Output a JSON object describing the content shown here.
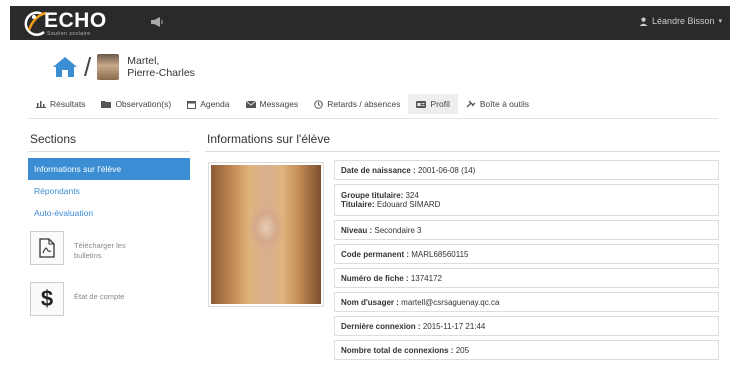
{
  "navbar": {
    "logo_text": "ECHO",
    "logo_subtitle": "Soutien scolaire",
    "user_name": "Léandre Bisson"
  },
  "breadcrumb": {
    "student_name_line1": "Martel,",
    "student_name_line2": "Pierre-Charles"
  },
  "tabs": [
    {
      "label": "Résultats",
      "icon": "bar-chart-icon"
    },
    {
      "label": "Observation(s)",
      "icon": "folder-icon"
    },
    {
      "label": "Agenda",
      "icon": "calendar-icon"
    },
    {
      "label": "Messages",
      "icon": "envelope-icon"
    },
    {
      "label": "Retards / absences",
      "icon": "clock-icon"
    },
    {
      "label": "Profil",
      "icon": "id-card-icon",
      "active": true
    },
    {
      "label": "Boîte à outils",
      "icon": "tools-icon"
    }
  ],
  "sections": {
    "title": "Sections",
    "items": [
      {
        "label": "Informations sur l'élève",
        "active": true
      },
      {
        "label": "Répondants"
      },
      {
        "label": "Auto-évaluation"
      }
    ],
    "report_card_label": "Télécharger les bulletins",
    "account_label": "État de compte"
  },
  "main": {
    "title": "Informations sur l'élève",
    "fields": {
      "birth_label": "Date de naissance :",
      "birth_value": "2001-06-08 (14)",
      "group_label": "Groupe titulaire:",
      "group_value": "324",
      "tutor_label": "Titulaire:",
      "tutor_value": "Edouard SIMARD",
      "level_label": "Niveau :",
      "level_value": "Secondaire 3",
      "code_label": "Code permanent :",
      "code_value": "MARL68560115",
      "file_label": "Numéro de fiche :",
      "file_value": "1374172",
      "username_label": "Nom d'usager :",
      "username_value": "martell@csrsaguenay.qc.ca",
      "lastlogin_label": "Dernière connexion :",
      "lastlogin_value": "2015-11-17 21:44",
      "total_label": "Nombre total de connexions :",
      "total_value": "205"
    }
  },
  "colors": {
    "navbar": "#2a2a2a",
    "accent": "#3b8ed4",
    "logo_swoosh": "#f39c12"
  }
}
